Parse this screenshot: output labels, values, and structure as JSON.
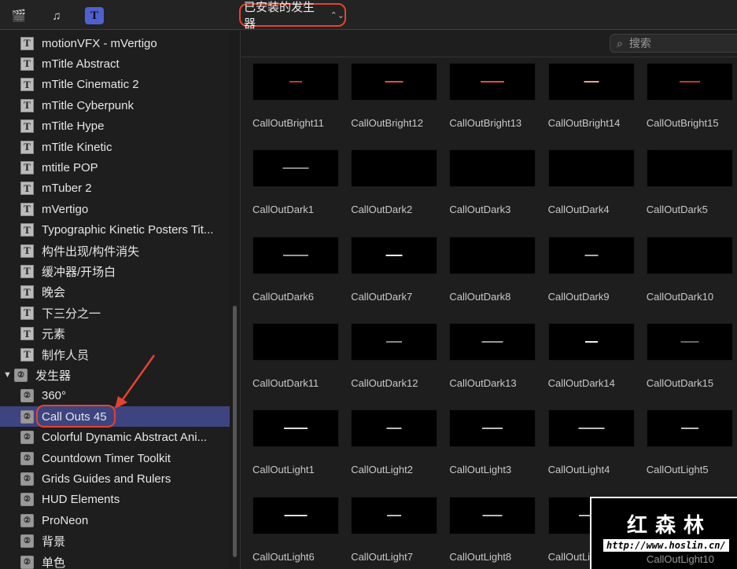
{
  "toolbar": {
    "icons": [
      "clapper-star-icon",
      "music-photo-icon",
      "titles-generators-icon"
    ],
    "selector_label": "已安装的发生器",
    "selector_chevron": "⌃⌄"
  },
  "search": {
    "placeholder": "搜索",
    "icon": "magnifier-icon"
  },
  "sidebar": {
    "items": [
      {
        "label": "motionVFX - mVertigo",
        "icon": "T"
      },
      {
        "label": "mTitle Abstract",
        "icon": "T"
      },
      {
        "label": "mTitle Cinematic 2",
        "icon": "T"
      },
      {
        "label": "mTitle Cyberpunk",
        "icon": "T"
      },
      {
        "label": "mTitle Hype",
        "icon": "T"
      },
      {
        "label": "mTitle Kinetic",
        "icon": "T"
      },
      {
        "label": "mtitle POP",
        "icon": "T"
      },
      {
        "label": "mTuber 2",
        "icon": "T"
      },
      {
        "label": "mVertigo",
        "icon": "T"
      },
      {
        "label": "Typographic Kinetic Posters Tit...",
        "icon": "T"
      },
      {
        "label": "构件出现/构件消失",
        "icon": "T"
      },
      {
        "label": "缓冲器/开场白",
        "icon": "T"
      },
      {
        "label": "晚会",
        "icon": "T"
      },
      {
        "label": "下三分之一",
        "icon": "T"
      },
      {
        "label": "元素",
        "icon": "T"
      },
      {
        "label": "制作人员",
        "icon": "T"
      },
      {
        "label": "发生器",
        "icon": "②",
        "group": true
      },
      {
        "label": "360°",
        "icon": "②"
      },
      {
        "label": "Call Outs 45",
        "icon": "②",
        "selected": true
      },
      {
        "label": "Colorful Dynamic Abstract Ani...",
        "icon": "②"
      },
      {
        "label": "Countdown Timer Toolkit",
        "icon": "②"
      },
      {
        "label": "Grids Guides and Rulers",
        "icon": "②"
      },
      {
        "label": "HUD Elements",
        "icon": "②"
      },
      {
        "label": "ProNeon",
        "icon": "②"
      },
      {
        "label": "背景",
        "icon": "②"
      },
      {
        "label": "单色",
        "icon": "②"
      }
    ]
  },
  "grid": {
    "items": [
      {
        "label": "CallOutBright11",
        "mark": "#c0392b"
      },
      {
        "label": "CallOutBright12",
        "mark": "#e05040"
      },
      {
        "label": "CallOutBright13",
        "mark": "#e05040"
      },
      {
        "label": "CallOutBright14",
        "mark": "#f0a0a0"
      },
      {
        "label": "CallOutBright15",
        "mark": "#c0392b"
      },
      {
        "label": "CallOutDark1",
        "mark": "#888"
      },
      {
        "label": "CallOutDark2",
        "mark": ""
      },
      {
        "label": "CallOutDark3",
        "mark": ""
      },
      {
        "label": "CallOutDark4",
        "mark": ""
      },
      {
        "label": "CallOutDark5",
        "mark": ""
      },
      {
        "label": "CallOutDark6",
        "mark": "#999"
      },
      {
        "label": "CallOutDark7",
        "mark": "#eee"
      },
      {
        "label": "CallOutDark8",
        "mark": ""
      },
      {
        "label": "CallOutDark9",
        "mark": "#aaa"
      },
      {
        "label": "CallOutDark10",
        "mark": ""
      },
      {
        "label": "CallOutDark11",
        "mark": ""
      },
      {
        "label": "CallOutDark12",
        "mark": "#888"
      },
      {
        "label": "CallOutDark13",
        "mark": "#999"
      },
      {
        "label": "CallOutDark14",
        "mark": "#eee"
      },
      {
        "label": "CallOutDark15",
        "mark": "#666"
      },
      {
        "label": "CallOutLight1",
        "mark": "#ddd"
      },
      {
        "label": "CallOutLight2",
        "mark": "#bbb"
      },
      {
        "label": "CallOutLight3",
        "mark": "#bbb"
      },
      {
        "label": "CallOutLight4",
        "mark": "#bbb"
      },
      {
        "label": "CallOutLight5",
        "mark": "#bbb"
      },
      {
        "label": "CallOutLight6",
        "mark": "#ddd"
      },
      {
        "label": "CallOutLight7",
        "mark": "#bbb"
      },
      {
        "label": "CallOutLight8",
        "mark": "#bbb"
      },
      {
        "label": "CallOutLight9",
        "mark": "#bbb"
      },
      {
        "label": "CallOutLight10",
        "mark": ""
      }
    ]
  },
  "watermark": {
    "title": "红森林",
    "url": "http://www.hoslin.cn/"
  }
}
